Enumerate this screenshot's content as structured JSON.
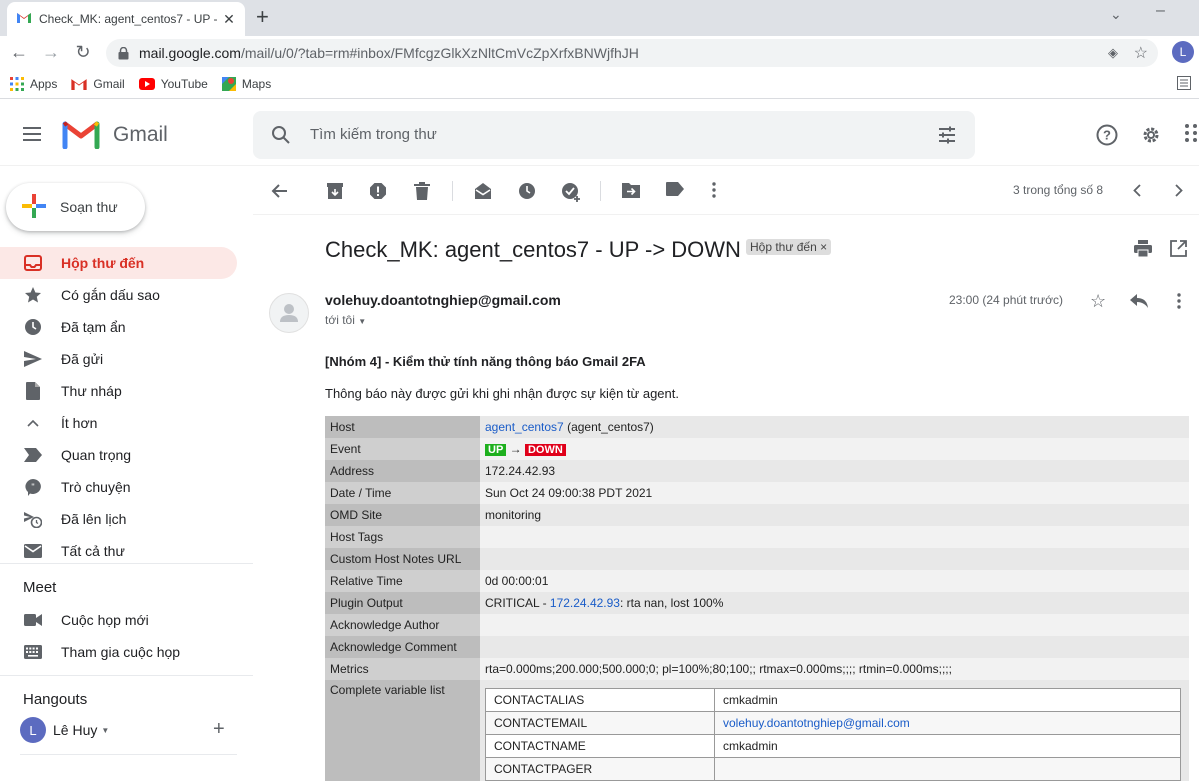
{
  "browser": {
    "tab_title": "Check_MK: agent_centos7 - UP -",
    "url_domain": "mail.google.com",
    "url_rest": "/mail/u/0/?tab=rm#inbox/FMfcgzGlkXzNltCmVcZpXrfxBNWjfhJH",
    "profile_initial": "L",
    "bookmarks": [
      {
        "label": "Apps",
        "icon": "apps-grid-icon"
      },
      {
        "label": "Gmail",
        "icon": "gmail-icon"
      },
      {
        "label": "YouTube",
        "icon": "youtube-icon"
      },
      {
        "label": "Maps",
        "icon": "maps-icon"
      }
    ]
  },
  "header": {
    "app_name": "Gmail",
    "search_placeholder": "Tìm kiếm trong thư"
  },
  "sidebar": {
    "compose_label": "Soạn thư",
    "items": [
      {
        "label": "Hộp thư đến",
        "icon": "inbox-icon",
        "active": true
      },
      {
        "label": "Có gắn dấu sao",
        "icon": "star-icon"
      },
      {
        "label": "Đã tạm ẩn",
        "icon": "clock-icon"
      },
      {
        "label": "Đã gửi",
        "icon": "send-icon"
      },
      {
        "label": "Thư nháp",
        "icon": "draft-icon"
      },
      {
        "label": "Ít hơn",
        "icon": "chevron-up-icon"
      },
      {
        "label": "Quan trọng",
        "icon": "important-icon"
      },
      {
        "label": "Trò chuyện",
        "icon": "chat-icon"
      },
      {
        "label": "Đã lên lịch",
        "icon": "scheduled-icon"
      },
      {
        "label": "Tất cả thư",
        "icon": "mail-icon"
      }
    ],
    "meet_heading": "Meet",
    "meet_items": [
      {
        "label": "Cuộc họp mới",
        "icon": "video-icon"
      },
      {
        "label": "Tham gia cuộc họp",
        "icon": "keyboard-icon"
      }
    ],
    "hangouts_heading": "Hangouts",
    "hangouts_user": "Lê Huy",
    "hangouts_initial": "L"
  },
  "toolbar": {
    "pager": "3 trong tổng số 8"
  },
  "message": {
    "subject": "Check_MK: agent_centos7 - UP -> DOWN",
    "label": "Hộp thư đến",
    "label_close": "×",
    "sender": "volehuy.doantotnghiep@gmail.com",
    "to": "tới tôi",
    "time": "23:00 (24 phút trước)",
    "title": "[Nhóm 4] - Kiểm thử tính năng thông báo Gmail 2FA",
    "intro": "Thông báo này được gửi khi ghi nhận được sự kiện từ agent."
  },
  "info": {
    "host_link": "agent_centos7",
    "host_paren": "(agent_centos7)",
    "event_from": "UP",
    "event_arrow": "→",
    "event_to": "DOWN",
    "plugin_prefix": "CRITICAL - ",
    "plugin_link": "172.24.42.93",
    "plugin_suffix": ": rta nan, lost 100%",
    "rows": [
      {
        "key": "Address",
        "value": "172.24.42.93"
      },
      {
        "key": "Date / Time",
        "value": "Sun Oct 24 09:00:38 PDT 2021"
      },
      {
        "key": "OMD Site",
        "value": "monitoring"
      },
      {
        "key": "Host Tags",
        "value": ""
      },
      {
        "key": "Custom Host Notes URL",
        "value": ""
      },
      {
        "key": "Relative Time",
        "value": "0d 00:00:01"
      }
    ],
    "rows2": [
      {
        "key": "Acknowledge Author",
        "value": ""
      },
      {
        "key": "Acknowledge Comment",
        "value": ""
      },
      {
        "key": "Metrics",
        "value": "rta=0.000ms;200.000;500.000;0; pl=100%;80;100;; rtmax=0.000ms;;;; rtmin=0.000ms;;;;"
      }
    ],
    "labels": {
      "host": "Host",
      "event": "Event",
      "plugin": "Plugin Output",
      "complete": "Complete variable list"
    },
    "vars": [
      {
        "key": "CONTACTALIAS",
        "value": "cmkadmin"
      },
      {
        "key": "CONTACTEMAIL",
        "value": "volehuy.doantotnghiep@gmail.com",
        "link": true
      },
      {
        "key": "CONTACTNAME",
        "value": "cmkadmin"
      },
      {
        "key": "CONTACTPAGER",
        "value": ""
      }
    ]
  }
}
